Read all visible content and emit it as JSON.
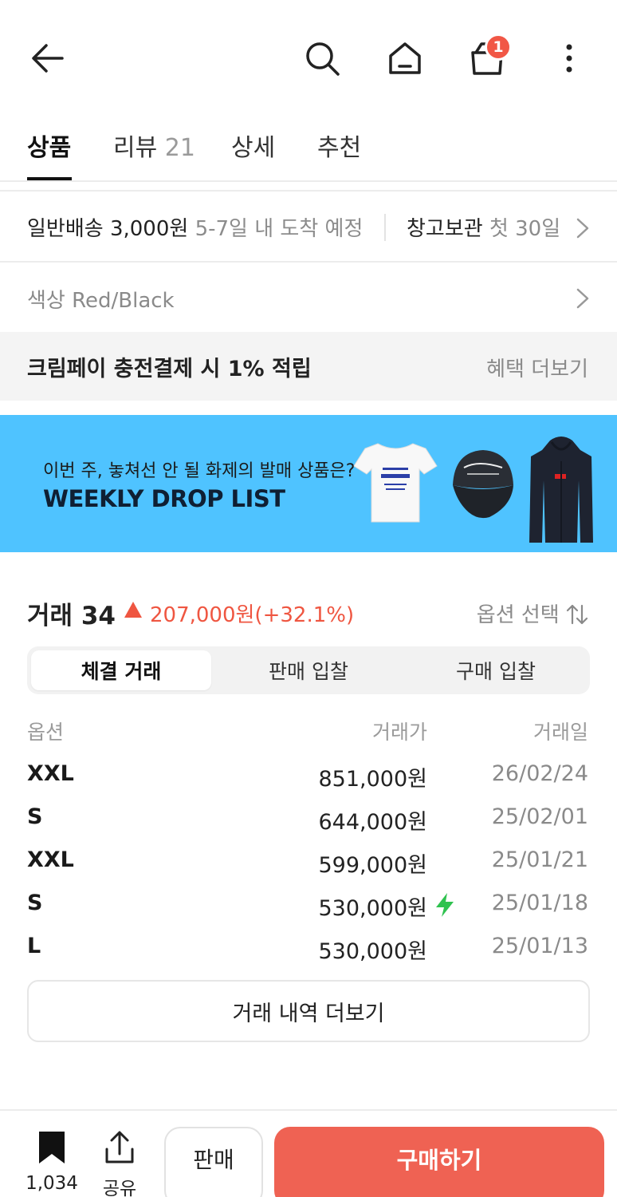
{
  "header": {
    "cart_badge": "1",
    "icons": [
      "back-arrow-icon",
      "search-icon",
      "home-icon",
      "shopping-bag-icon",
      "more-vertical-icon"
    ]
  },
  "tabs": [
    {
      "label": "상품",
      "count": ""
    },
    {
      "label": "리뷰",
      "count": "21"
    },
    {
      "label": "상세",
      "count": ""
    },
    {
      "label": "추천",
      "count": ""
    }
  ],
  "delivery": {
    "label": "일반배송 3,000원",
    "eta": "5-7일 내 도착 예정",
    "storage_label": "창고보관",
    "storage_sub": "첫 30일"
  },
  "color_option": "색상 Red/Black",
  "benefit": {
    "text": "크림페이 충전결제 시 1% 적립",
    "more": "혜택 더보기"
  },
  "banner": {
    "subtitle": "이번 주, 놓쳐선 안 될 화제의 발매 상품은?",
    "title": "WEEKLY DROP LIST",
    "bg_color": "#4fc3ff"
  },
  "trade": {
    "title": "거래 34",
    "change": "207,000원(+32.1%)",
    "option_select": "옵션 선택",
    "change_color": "#ef5641"
  },
  "segments": [
    "체결 거래",
    "판매 입찰",
    "구매 입찰"
  ],
  "table": {
    "headers": {
      "option": "옵션",
      "price": "거래가",
      "date": "거래일"
    },
    "rows": [
      {
        "option": "XXL",
        "price": "851,000원",
        "date": "26/02/24",
        "fast": false
      },
      {
        "option": "S",
        "price": "644,000원",
        "date": "25/02/01",
        "fast": false
      },
      {
        "option": "XXL",
        "price": "599,000원",
        "date": "25/01/21",
        "fast": false
      },
      {
        "option": "S",
        "price": "530,000원",
        "date": "25/01/18",
        "fast": true
      },
      {
        "option": "L",
        "price": "530,000원",
        "date": "25/01/13",
        "fast": false
      }
    ]
  },
  "more_trades": "거래 내역 더보기",
  "bottom": {
    "bookmark_count": "1,034",
    "share_label": "공유",
    "sell_label": "판매",
    "buy_label": "구매하기",
    "buy_color": "#ef6253"
  }
}
